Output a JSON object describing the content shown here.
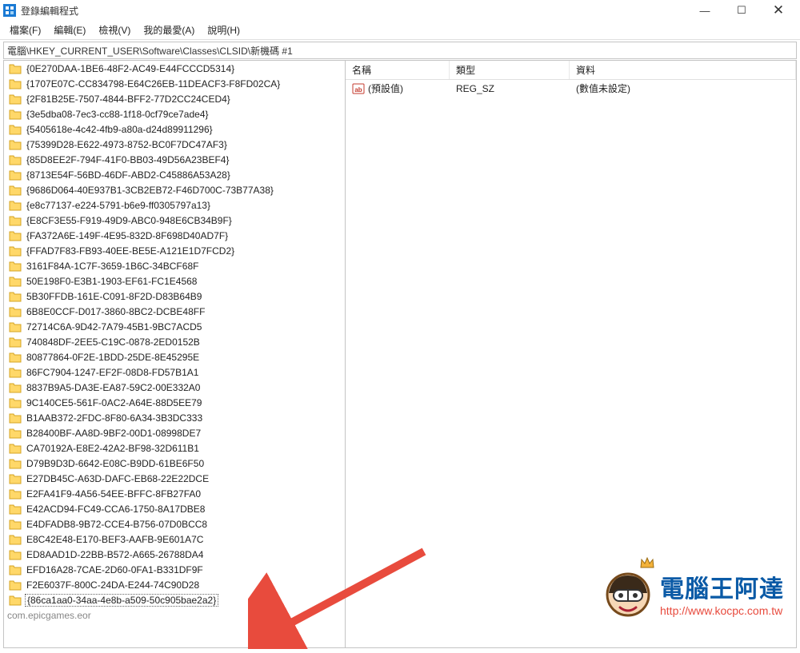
{
  "window": {
    "title": "登錄編輯程式",
    "min": "—",
    "max": "☐",
    "close": "✕"
  },
  "menu": {
    "file": "檔案(F)",
    "edit": "編輯(E)",
    "view": "檢視(V)",
    "fav": "我的最愛(A)",
    "help": "說明(H)"
  },
  "path": "電腦\\HKEY_CURRENT_USER\\Software\\Classes\\CLSID\\新機碼 #1",
  "tree": [
    "{0E270DAA-1BE6-48F2-AC49-E44FCCCD5314}",
    "{1707E07C-CC834798-E64C26EB-11DEACF3-F8FD02CA}",
    "{2F81B25E-7507-4844-BFF2-77D2CC24CED4}",
    "{3e5dba08-7ec3-cc88-1f18-0cf79ce7ade4}",
    "{5405618e-4c42-4fb9-a80a-d24d89911296}",
    "{75399D28-E622-4973-8752-BC0F7DC47AF3}",
    "{85D8EE2F-794F-41F0-BB03-49D56A23BEF4}",
    "{8713E54F-56BD-46DF-ABD2-C45886A53A28}",
    "{9686D064-40E937B1-3CB2EB72-F46D700C-73B77A38}",
    "{e8c77137-e224-5791-b6e9-ff0305797a13}",
    "{E8CF3E55-F919-49D9-ABC0-948E6CB34B9F}",
    "{FA372A6E-149F-4E95-832D-8F698D40AD7F}",
    "{FFAD7F83-FB93-40EE-BE5E-A121E1D7FCD2}",
    "3161F84A-1C7F-3659-1B6C-34BCF68F",
    "50E198F0-E3B1-1903-EF61-FC1E4568",
    "5B30FFDB-161E-C091-8F2D-D83B64B9",
    "6B8E0CCF-D017-3860-8BC2-DCBE48FF",
    "72714C6A-9D42-7A79-45B1-9BC7ACD5",
    "740848DF-2EE5-C19C-0878-2ED0152B",
    "80877864-0F2E-1BDD-25DE-8E45295E",
    "86FC7904-1247-EF2F-08D8-FD57B1A1",
    "8837B9A5-DA3E-EA87-59C2-00E332A0",
    "9C140CE5-561F-0AC2-A64E-88D5EE79",
    "B1AAB372-2FDC-8F80-6A34-3B3DC333",
    "B28400BF-AA8D-9BF2-00D1-08998DE7",
    "CA70192A-E8E2-42A2-BF98-32D611B1",
    "D79B9D3D-6642-E08C-B9DD-61BE6F50",
    "E27DB45C-A63D-DAFC-EB68-22E22DCE",
    "E2FA41F9-4A56-54EE-BFFC-8FB27FA0",
    "E42ACD94-FC49-CCA6-1750-8A17DBE8",
    "E4DFADB8-9B72-CCE4-B756-07D0BCC8",
    "E8C42E48-E170-BEF3-AAFB-9E601A7C",
    "ED8AAD1D-22BB-B572-A665-26788DA4",
    "EFD16A28-7CAE-2D60-0FA1-B331DF9F",
    "F2E6037F-800C-24DA-E244-74C90D28"
  ],
  "tree_editing": "{86ca1aa0-34aa-4e8b-a509-50c905bae2a2}",
  "tree_last_partial": "com.epicgames.eor",
  "list": {
    "headers": {
      "name": "名稱",
      "type": "類型",
      "data": "資料"
    },
    "row": {
      "name": "(預設值)",
      "type": "REG_SZ",
      "data": "(數值未設定)"
    }
  },
  "watermark": {
    "title": "電腦王阿達",
    "url": "http://www.kocpc.com.tw"
  }
}
